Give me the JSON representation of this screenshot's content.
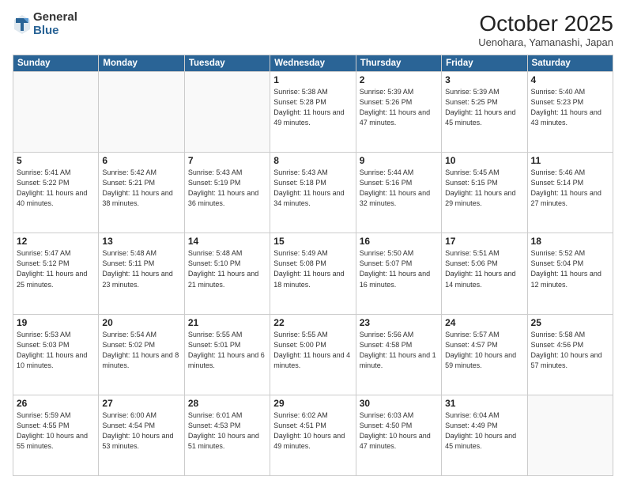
{
  "header": {
    "logo_general": "General",
    "logo_blue": "Blue",
    "month_title": "October 2025",
    "location": "Uenohara, Yamanashi, Japan"
  },
  "weekdays": [
    "Sunday",
    "Monday",
    "Tuesday",
    "Wednesday",
    "Thursday",
    "Friday",
    "Saturday"
  ],
  "weeks": [
    [
      {
        "day": "",
        "info": ""
      },
      {
        "day": "",
        "info": ""
      },
      {
        "day": "",
        "info": ""
      },
      {
        "day": "1",
        "info": "Sunrise: 5:38 AM\nSunset: 5:28 PM\nDaylight: 11 hours\nand 49 minutes."
      },
      {
        "day": "2",
        "info": "Sunrise: 5:39 AM\nSunset: 5:26 PM\nDaylight: 11 hours\nand 47 minutes."
      },
      {
        "day": "3",
        "info": "Sunrise: 5:39 AM\nSunset: 5:25 PM\nDaylight: 11 hours\nand 45 minutes."
      },
      {
        "day": "4",
        "info": "Sunrise: 5:40 AM\nSunset: 5:23 PM\nDaylight: 11 hours\nand 43 minutes."
      }
    ],
    [
      {
        "day": "5",
        "info": "Sunrise: 5:41 AM\nSunset: 5:22 PM\nDaylight: 11 hours\nand 40 minutes."
      },
      {
        "day": "6",
        "info": "Sunrise: 5:42 AM\nSunset: 5:21 PM\nDaylight: 11 hours\nand 38 minutes."
      },
      {
        "day": "7",
        "info": "Sunrise: 5:43 AM\nSunset: 5:19 PM\nDaylight: 11 hours\nand 36 minutes."
      },
      {
        "day": "8",
        "info": "Sunrise: 5:43 AM\nSunset: 5:18 PM\nDaylight: 11 hours\nand 34 minutes."
      },
      {
        "day": "9",
        "info": "Sunrise: 5:44 AM\nSunset: 5:16 PM\nDaylight: 11 hours\nand 32 minutes."
      },
      {
        "day": "10",
        "info": "Sunrise: 5:45 AM\nSunset: 5:15 PM\nDaylight: 11 hours\nand 29 minutes."
      },
      {
        "day": "11",
        "info": "Sunrise: 5:46 AM\nSunset: 5:14 PM\nDaylight: 11 hours\nand 27 minutes."
      }
    ],
    [
      {
        "day": "12",
        "info": "Sunrise: 5:47 AM\nSunset: 5:12 PM\nDaylight: 11 hours\nand 25 minutes."
      },
      {
        "day": "13",
        "info": "Sunrise: 5:48 AM\nSunset: 5:11 PM\nDaylight: 11 hours\nand 23 minutes."
      },
      {
        "day": "14",
        "info": "Sunrise: 5:48 AM\nSunset: 5:10 PM\nDaylight: 11 hours\nand 21 minutes."
      },
      {
        "day": "15",
        "info": "Sunrise: 5:49 AM\nSunset: 5:08 PM\nDaylight: 11 hours\nand 18 minutes."
      },
      {
        "day": "16",
        "info": "Sunrise: 5:50 AM\nSunset: 5:07 PM\nDaylight: 11 hours\nand 16 minutes."
      },
      {
        "day": "17",
        "info": "Sunrise: 5:51 AM\nSunset: 5:06 PM\nDaylight: 11 hours\nand 14 minutes."
      },
      {
        "day": "18",
        "info": "Sunrise: 5:52 AM\nSunset: 5:04 PM\nDaylight: 11 hours\nand 12 minutes."
      }
    ],
    [
      {
        "day": "19",
        "info": "Sunrise: 5:53 AM\nSunset: 5:03 PM\nDaylight: 11 hours\nand 10 minutes."
      },
      {
        "day": "20",
        "info": "Sunrise: 5:54 AM\nSunset: 5:02 PM\nDaylight: 11 hours\nand 8 minutes."
      },
      {
        "day": "21",
        "info": "Sunrise: 5:55 AM\nSunset: 5:01 PM\nDaylight: 11 hours\nand 6 minutes."
      },
      {
        "day": "22",
        "info": "Sunrise: 5:55 AM\nSunset: 5:00 PM\nDaylight: 11 hours\nand 4 minutes."
      },
      {
        "day": "23",
        "info": "Sunrise: 5:56 AM\nSunset: 4:58 PM\nDaylight: 11 hours\nand 1 minute."
      },
      {
        "day": "24",
        "info": "Sunrise: 5:57 AM\nSunset: 4:57 PM\nDaylight: 10 hours\nand 59 minutes."
      },
      {
        "day": "25",
        "info": "Sunrise: 5:58 AM\nSunset: 4:56 PM\nDaylight: 10 hours\nand 57 minutes."
      }
    ],
    [
      {
        "day": "26",
        "info": "Sunrise: 5:59 AM\nSunset: 4:55 PM\nDaylight: 10 hours\nand 55 minutes."
      },
      {
        "day": "27",
        "info": "Sunrise: 6:00 AM\nSunset: 4:54 PM\nDaylight: 10 hours\nand 53 minutes."
      },
      {
        "day": "28",
        "info": "Sunrise: 6:01 AM\nSunset: 4:53 PM\nDaylight: 10 hours\nand 51 minutes."
      },
      {
        "day": "29",
        "info": "Sunrise: 6:02 AM\nSunset: 4:51 PM\nDaylight: 10 hours\nand 49 minutes."
      },
      {
        "day": "30",
        "info": "Sunrise: 6:03 AM\nSunset: 4:50 PM\nDaylight: 10 hours\nand 47 minutes."
      },
      {
        "day": "31",
        "info": "Sunrise: 6:04 AM\nSunset: 4:49 PM\nDaylight: 10 hours\nand 45 minutes."
      },
      {
        "day": "",
        "info": ""
      }
    ]
  ]
}
